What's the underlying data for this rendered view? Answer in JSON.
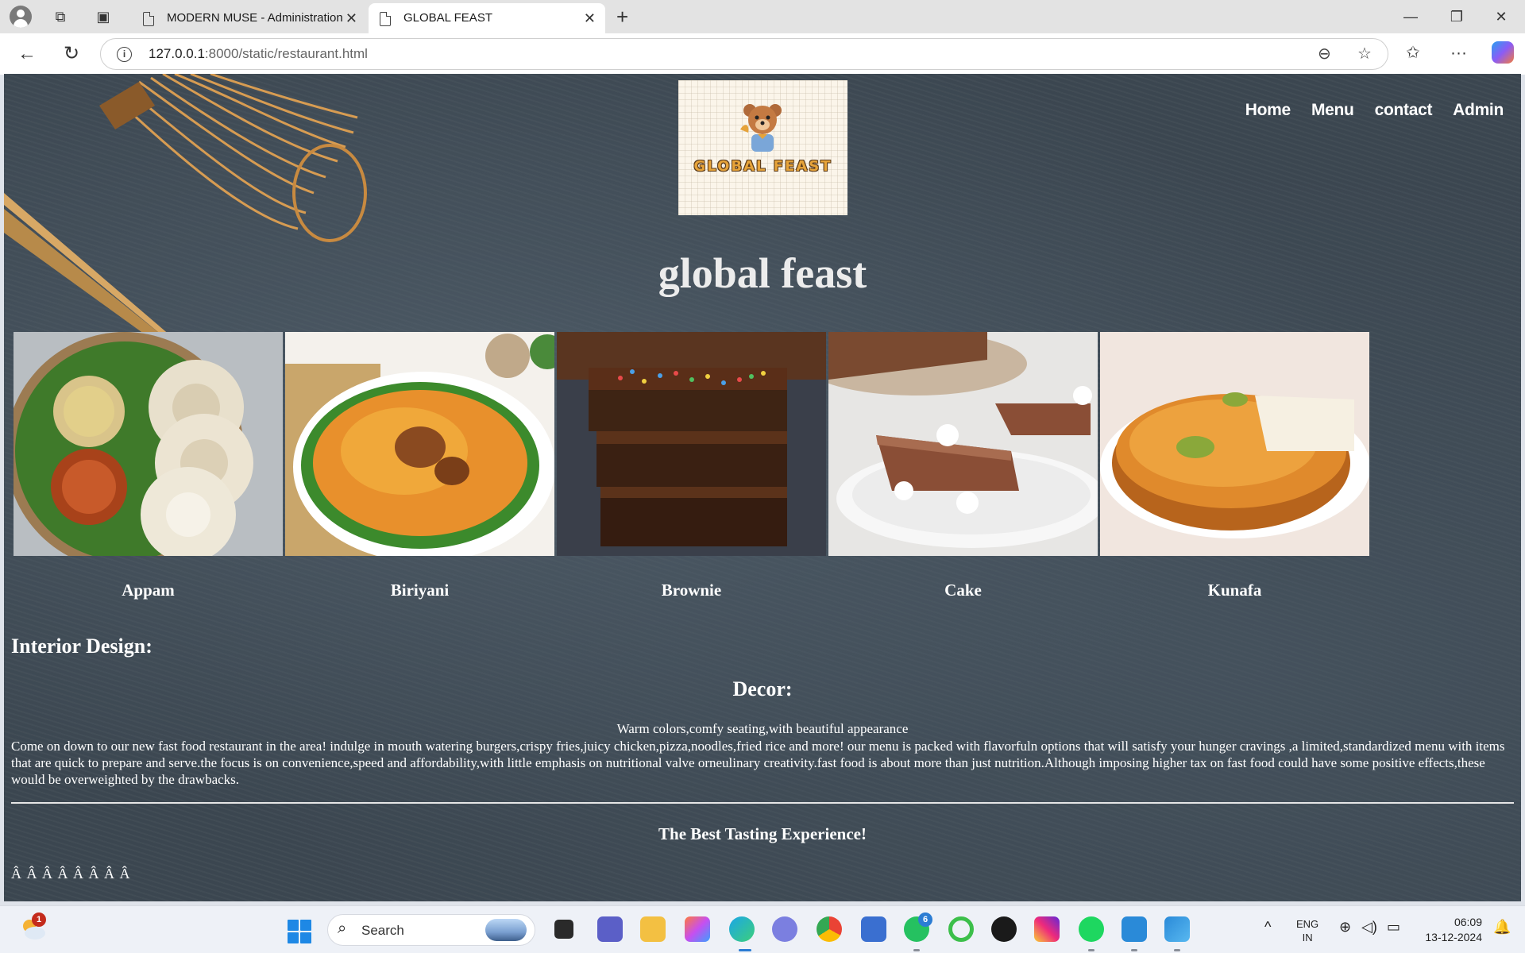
{
  "browser": {
    "tabs": [
      {
        "title": "MODERN MUSE - Administration",
        "active": false
      },
      {
        "title": "GLOBAL FEAST",
        "active": true
      }
    ],
    "url_host": "127.0.0.1",
    "url_rest": ":8000/static/restaurant.html"
  },
  "site": {
    "logo_text": "GLOBAL FEAST",
    "nav": [
      "Home",
      "Menu",
      "contact",
      "Admin"
    ],
    "title": "global feast",
    "dishes": [
      {
        "name": "Appam"
      },
      {
        "name": "Biriyani"
      },
      {
        "name": "Brownie"
      },
      {
        "name": "Cake"
      },
      {
        "name": "Kunafa"
      }
    ],
    "interior_heading": "Interior Design:",
    "decor_heading": "Decor:",
    "decor_text": "Warm colors,comfy seating,with beautiful appearance",
    "paragraph": "Come on down to our new fast food restaurant in the area! indulge in mouth watering burgers,crispy fries,juicy chicken,pizza,noodles,fried rice and more! our menu is packed with flavorfuln options that will satisfy your hunger cravings ,a limited,standardized menu with items that are quick to prepare and serve.the focus is on convenience,speed and affordability,with little emphasis on nutritional valve orneulinary creativity.fast food is about more than just nutrition.Although imposing higher tax on fast food could have some positive effects,these would be overweighted by the drawbacks.",
    "tagline": "The Best Tasting Experience!",
    "garbled": "Â Â Â Â Â Â Â Â"
  },
  "taskbar": {
    "search_placeholder": "Search",
    "weather_badge": "1",
    "whatsapp_badge": "6",
    "lang_line1": "ENG",
    "lang_line2": "IN",
    "time": "06:09",
    "date": "13-12-2024"
  },
  "colors": {
    "page_bg": "#3b4650",
    "taskbar_bg": "#eef1f7",
    "logo_accent": "#e6a33a"
  }
}
